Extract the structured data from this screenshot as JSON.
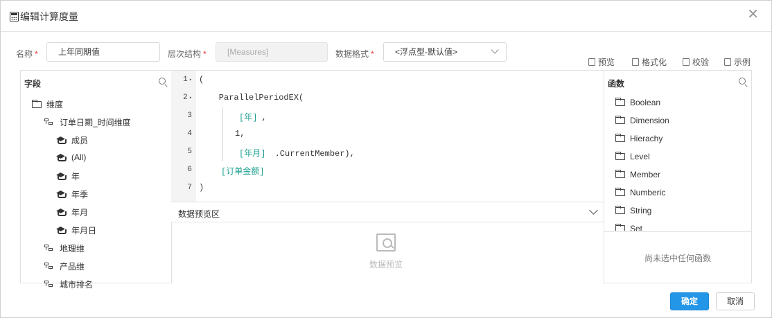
{
  "dialog": {
    "title": "编辑计算度量"
  },
  "form": {
    "name_label": "名称",
    "name_value": "上年同期值",
    "hierarchy_label": "层次结构",
    "hierarchy_value": "[Measures]",
    "format_label": "数据格式",
    "format_value": "<浮点型-默认值>",
    "required_mark": "*"
  },
  "toolbar": {
    "preview": "预览",
    "format": "格式化",
    "validate": "校验",
    "example": "示例"
  },
  "fields": {
    "header": "字段",
    "items": [
      {
        "label": "维度",
        "icon": "folder-open-icon",
        "level": 0
      },
      {
        "label": "订单日期_时间维度",
        "icon": "hierarchy-icon",
        "level": 1
      },
      {
        "label": "成员",
        "icon": "layers-icon",
        "level": 2
      },
      {
        "label": "(All)",
        "icon": "layers-icon",
        "level": 2
      },
      {
        "label": "年",
        "icon": "layers-icon",
        "level": 2
      },
      {
        "label": "年季",
        "icon": "layers-icon",
        "level": 2
      },
      {
        "label": "年月",
        "icon": "layers-icon",
        "level": 2
      },
      {
        "label": "年月日",
        "icon": "layers-icon",
        "level": 2
      },
      {
        "label": "地理维",
        "icon": "hierarchy-icon",
        "level": 1
      },
      {
        "label": "产品维",
        "icon": "hierarchy-icon",
        "level": 1
      },
      {
        "label": "城市排名",
        "icon": "hierarchy-icon",
        "level": 1
      }
    ]
  },
  "editor": {
    "line_numbers": [
      "1",
      "2",
      "3",
      "4",
      "5",
      "6",
      "7"
    ],
    "lines": [
      {
        "text": "(",
        "kw": ""
      },
      {
        "text": "    ParallelPeriodEX(",
        "kw": ""
      },
      {
        "text": ",",
        "kw": "[年]"
      },
      {
        "text": "1,",
        "kw": ""
      },
      {
        "text": " .CurrentMember),",
        "kw": "[年月]"
      },
      {
        "text": "",
        "kw": "[订单金额]"
      },
      {
        "text": ")",
        "kw": ""
      }
    ]
  },
  "preview": {
    "title": "数据预览区",
    "empty_text": "数据预览"
  },
  "functions": {
    "header": "函数",
    "items": [
      "Boolean",
      "Dimension",
      "Hierachy",
      "Level",
      "Member",
      "Numberic",
      "String",
      "Set"
    ],
    "empty_text": "尚未选中任何函数"
  },
  "buttons": {
    "ok": "确定",
    "cancel": "取消"
  }
}
